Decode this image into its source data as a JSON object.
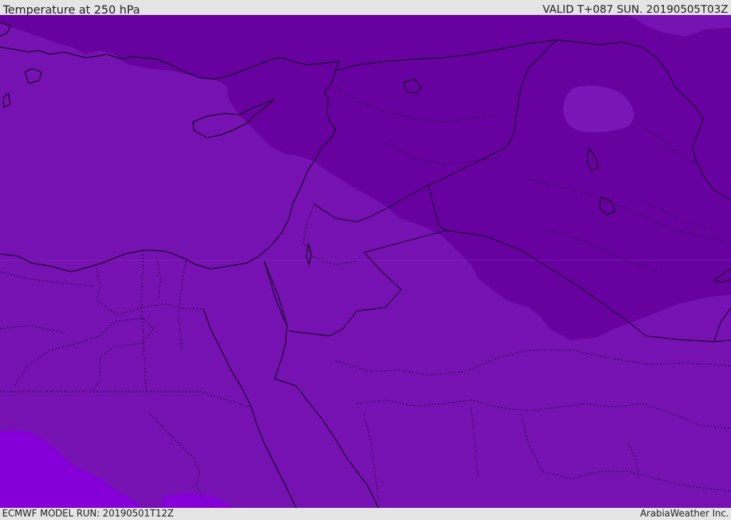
{
  "header": {
    "title": "Temperature at 250 hPa",
    "valid_time": "VALID T+087 SUN. 20190505T03Z"
  },
  "footer": {
    "model_run": "ECMWF MODEL RUN: 20190501T12Z",
    "credit": "ArabiaWeather Inc."
  },
  "colors": {
    "base_fill": "#7512b1",
    "cold_fill": "#6702a0",
    "warm_fill": "#8500d8",
    "light_patch": "#7a16b8",
    "border_line": "#000000"
  }
}
